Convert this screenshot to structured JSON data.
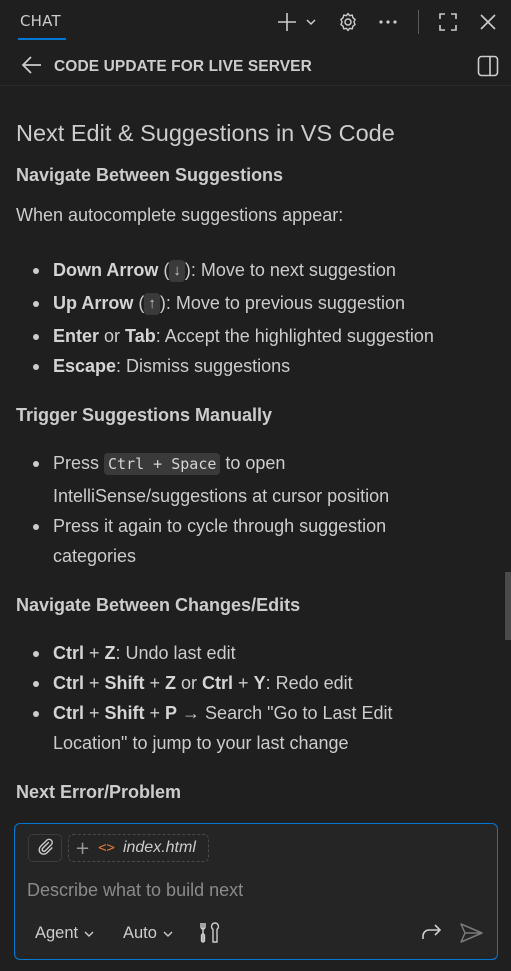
{
  "topbar": {
    "tab_label": "CHAT",
    "icons": [
      "plus-icon",
      "chevron-down-icon",
      "gear-icon",
      "more-icon",
      "maximize-icon",
      "close-icon"
    ]
  },
  "titlebar": {
    "title": "CODE UPDATE FOR LIVE SERVER",
    "icons": [
      "back-arrow-icon",
      "panel-layout-icon"
    ]
  },
  "content": {
    "heading": "Next Edit & Suggestions in VS Code",
    "section1": {
      "title": "Navigate Between Suggestions",
      "intro": "When autocomplete suggestions appear:",
      "items": [
        {
          "key": "Down Arrow",
          "kbd": "↓",
          "text": ": Move to next suggestion"
        },
        {
          "key": "Up Arrow",
          "kbd": "↑",
          "text": ": Move to previous suggestion"
        },
        {
          "key1": "Enter",
          "mid": " or ",
          "key2": "Tab",
          "text": ": Accept the highlighted suggestion"
        },
        {
          "key": "Escape",
          "text": ": Dismiss suggestions"
        }
      ]
    },
    "section2": {
      "title": "Trigger Suggestions Manually",
      "items": [
        {
          "pre": "Press ",
          "code": "Ctrl + Space",
          "post": " to open",
          "line2": "IntelliSense/suggestions at cursor position"
        },
        {
          "line1": "Press it again to cycle through suggestion",
          "line2": "categories"
        }
      ]
    },
    "section3": {
      "title": "Navigate Between Changes/Edits",
      "items": [
        {
          "k1": "Ctrl",
          "plus1": " + ",
          "k2": "Z",
          "text": ": Undo last edit"
        },
        {
          "k1": "Ctrl",
          "plus1": " + ",
          "k2": "Shift",
          "plus2": " + ",
          "k3": "Z",
          "mid": " or ",
          "k4": "Ctrl",
          "plus3": " + ",
          "k5": "Y",
          "text": ": Redo edit"
        },
        {
          "k1": "Ctrl",
          "plus1": " + ",
          "k2": "Shift",
          "plus2": " + ",
          "k3": "P",
          "text": " → Search \"Go to Last Edit",
          "line2": "Location\" to jump to your last change"
        }
      ]
    },
    "section4": {
      "title": "Next Error/Problem"
    }
  },
  "input": {
    "file_chip": "index.html",
    "placeholder": "Describe what to build next",
    "mode_label": "Agent",
    "model_label": "Auto",
    "icons": [
      "attach-icon",
      "add-context-icon",
      "tools-icon",
      "redirect-icon",
      "send-icon"
    ]
  },
  "colors": {
    "background": "#1f1f1f",
    "accent": "#0078d4",
    "text": "#cccccc",
    "file_icon": "#e37933"
  }
}
